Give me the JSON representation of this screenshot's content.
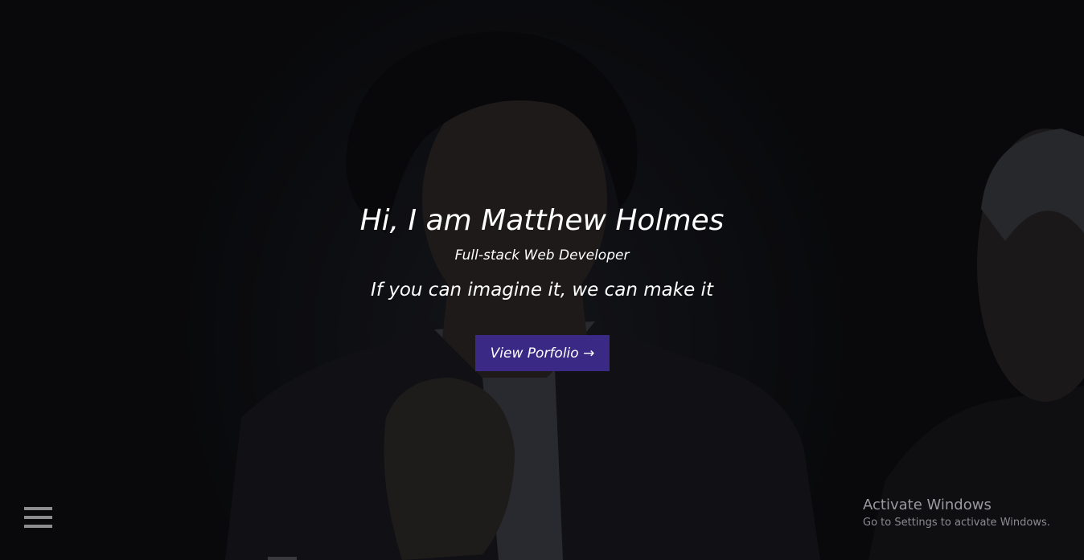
{
  "hero": {
    "title": "Hi, I am Matthew Holmes",
    "subtitle": "Full-stack Web Developer",
    "tagline": "If you can imagine it, we can make it",
    "cta_label": "View Porfolio →",
    "cta_color": "#3a2a86"
  },
  "nav": {
    "menu_icon": "hamburger-icon"
  },
  "watermark": {
    "title": "Activate Windows",
    "subtitle": "Go to Settings to activate Windows."
  }
}
